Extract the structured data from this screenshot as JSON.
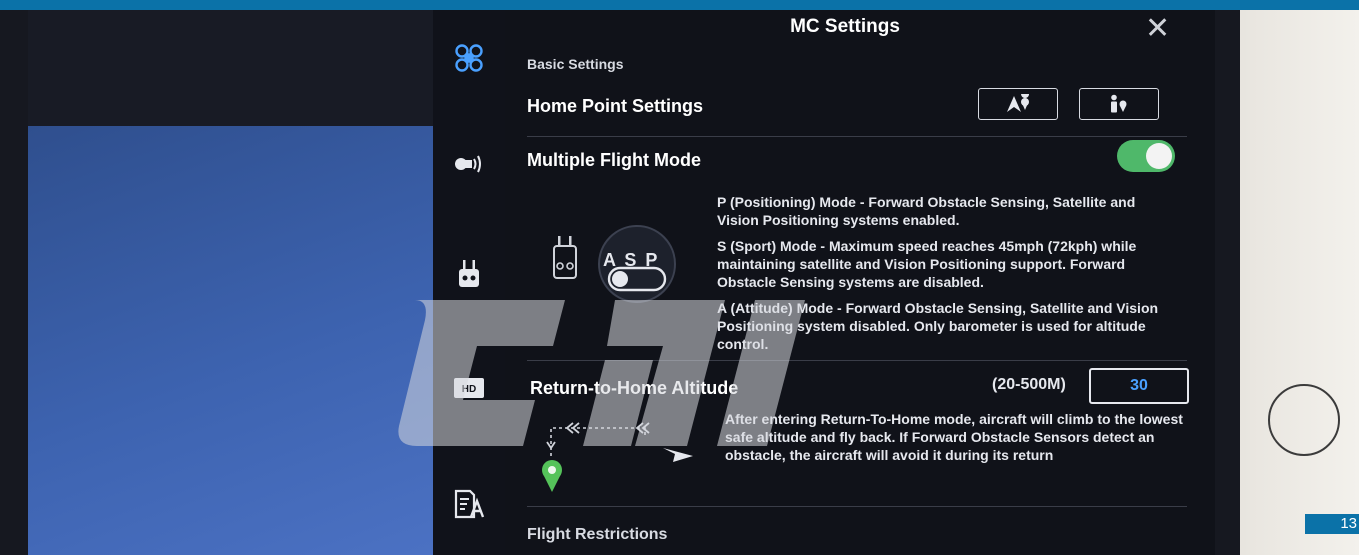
{
  "panel": {
    "title": "MC Settings",
    "close_glyph": "✕",
    "basic_section": "Basic Settings",
    "home_point": {
      "label": "Home Point Settings",
      "buttons": [
        {
          "icon": "aircraft-home-icon"
        },
        {
          "icon": "pilot-home-icon"
        }
      ]
    },
    "multiple_flight_mode": {
      "label": "Multiple Flight Mode",
      "enabled": true,
      "switch_letters": "A S P",
      "descriptions": [
        "P (Positioning) Mode - Forward Obstacle Sensing, Satellite and Vision Positioning systems enabled.",
        "S (Sport) Mode - Maximum speed reaches 45mph (72kph) while maintaining satellite and Vision Positioning support. Forward Obstacle Sensing systems are disabled.",
        "A (Attitude) Mode - Forward Obstacle Sensing, Satellite and Vision Positioning system disabled. Only barometer is used for altitude control."
      ]
    },
    "rth_altitude": {
      "label": "Return-to-Home Altitude",
      "range": "(20-500M)",
      "value": "30",
      "description": "After entering Return-To-Home mode, aircraft will climb to the lowest safe altitude and fly back. If Forward Obstacle Sensors detect an obstacle, the aircraft will avoid it during its return"
    },
    "flight_restrictions": {
      "label": "Flight Restrictions"
    }
  },
  "sidebar": {
    "items": [
      {
        "icon": "aircraft-icon",
        "active": true
      },
      {
        "icon": "remote-signal-icon"
      },
      {
        "icon": "remote-controller-icon"
      },
      {
        "icon": "hd-transmission-icon"
      },
      {
        "icon": "general-settings-icon"
      }
    ]
  },
  "overlay": {
    "page_number": "13"
  },
  "colors": {
    "accent": "#4fb86a",
    "value_blue": "#4aa0ff",
    "strip_blue": "#0b72a8"
  }
}
